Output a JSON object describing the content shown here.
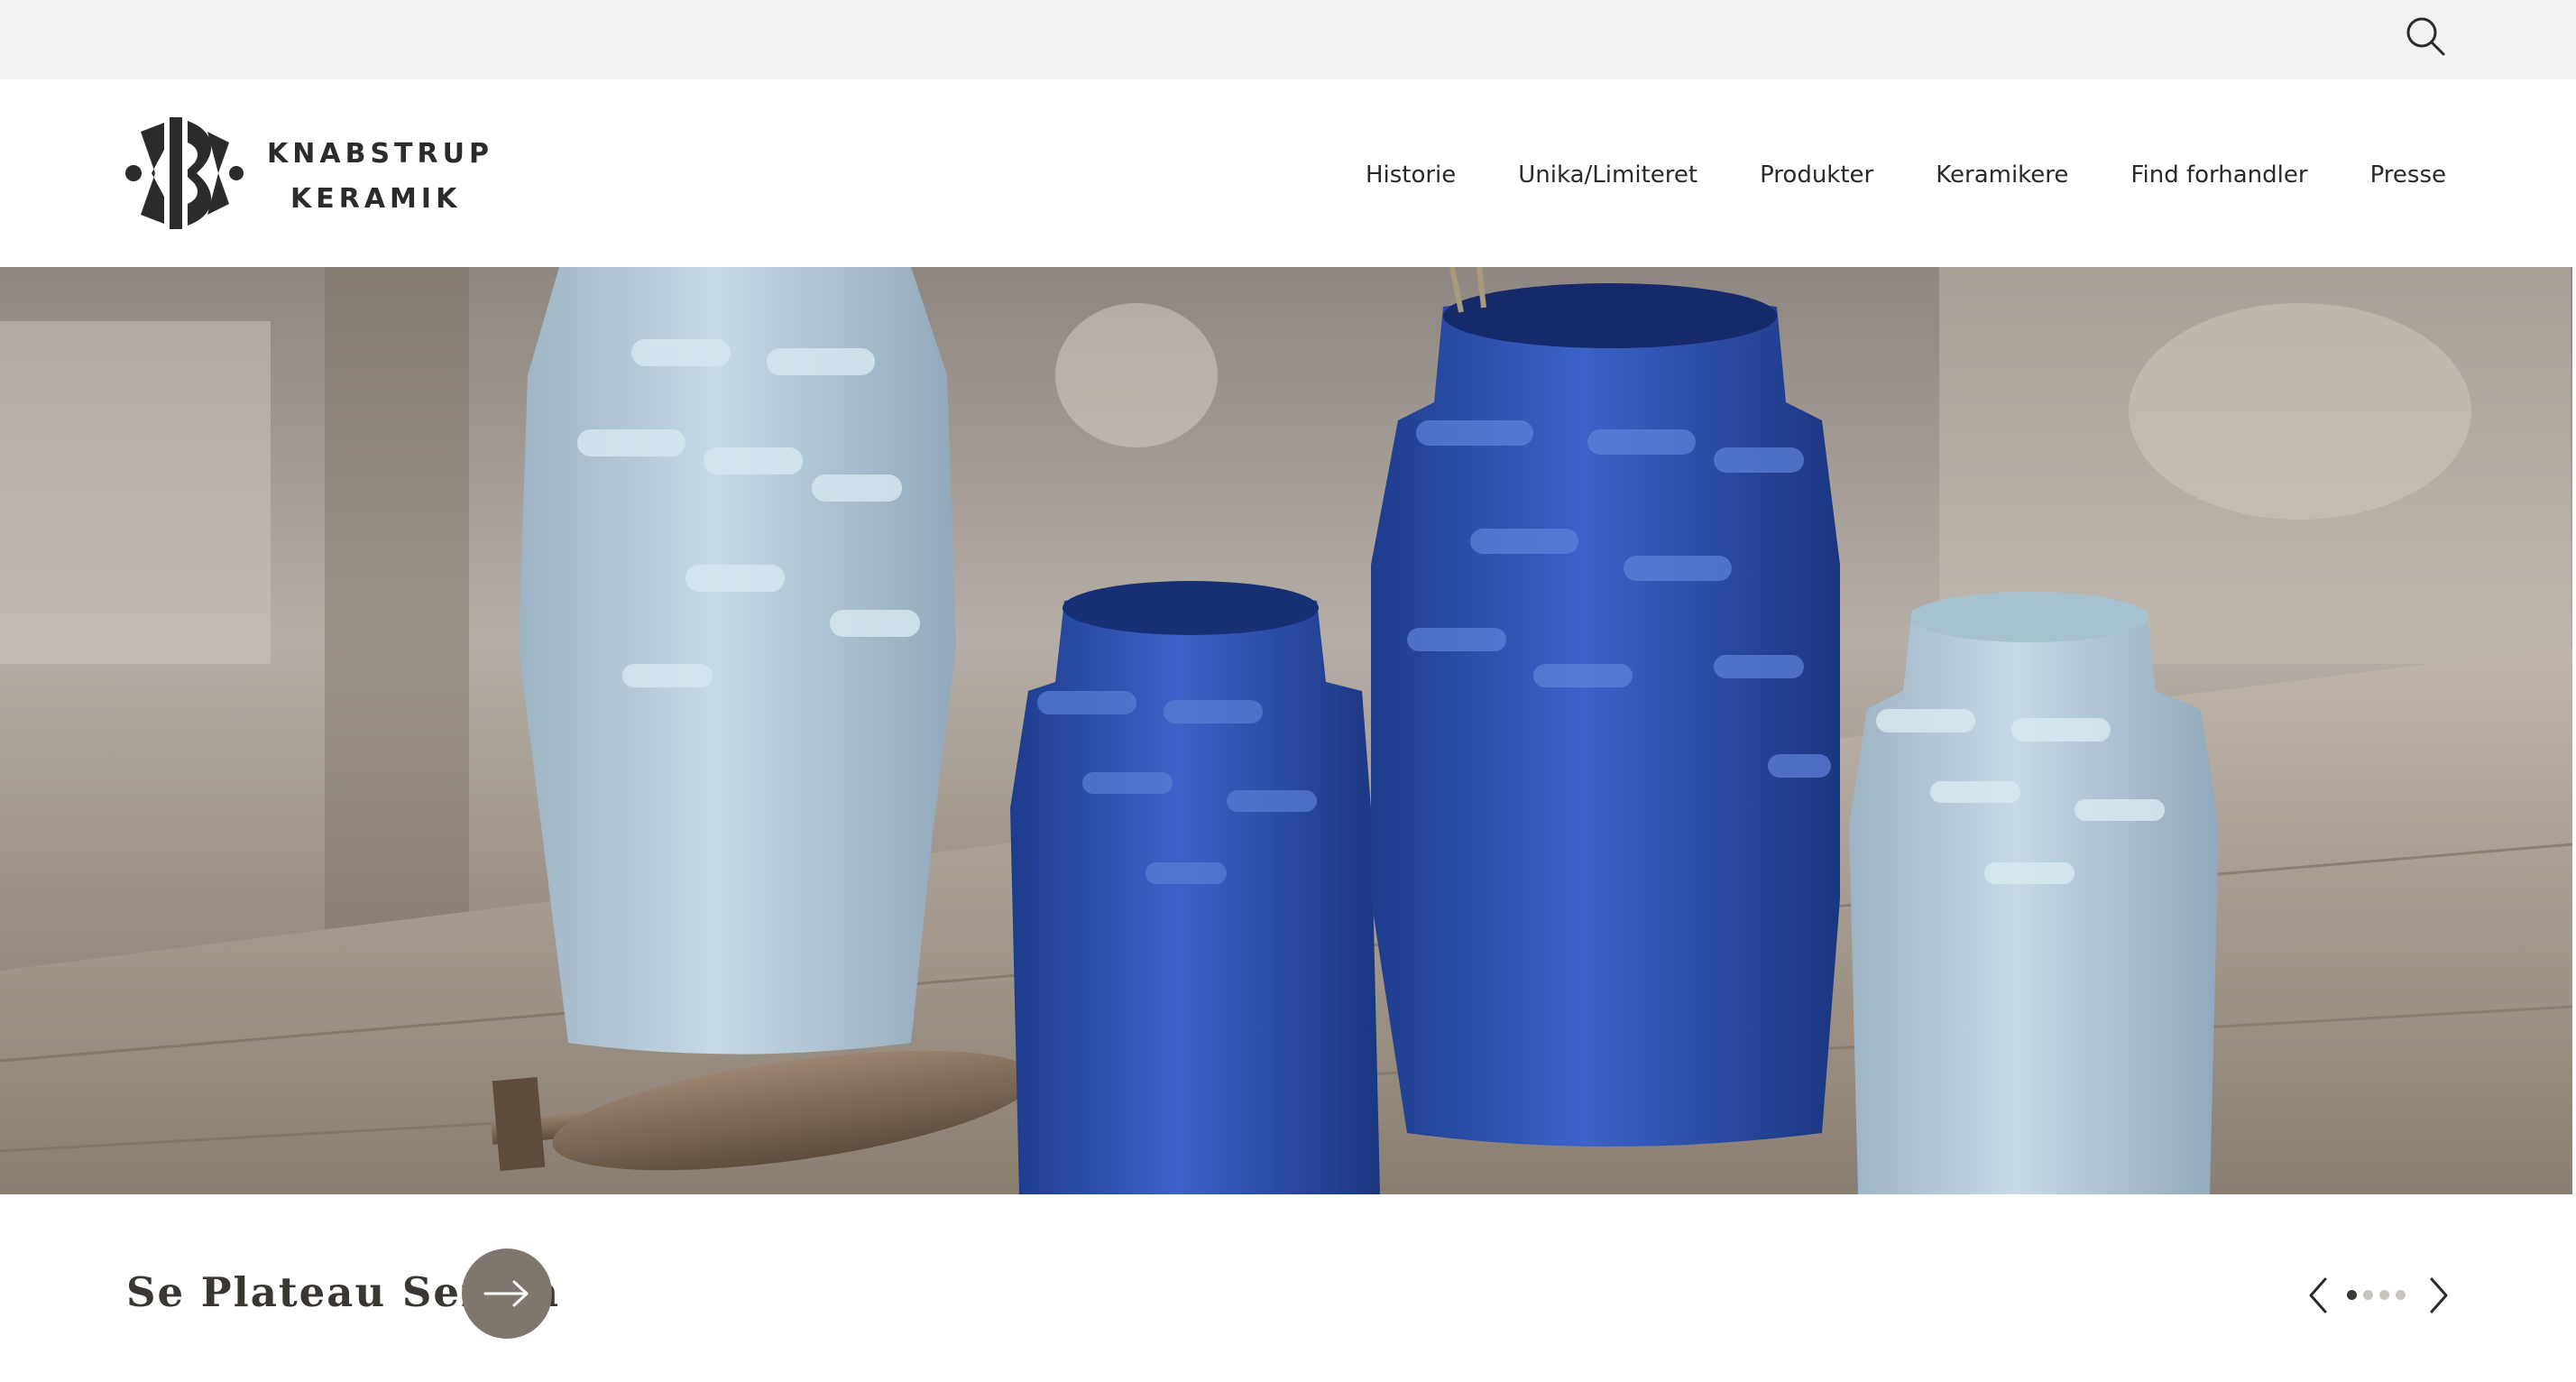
{
  "brand": {
    "name_line1": "KNABSTRUP",
    "name_line2": "KERAMIK"
  },
  "topbar": {
    "search_icon": "search-icon"
  },
  "nav": {
    "items": [
      {
        "label": "Historie"
      },
      {
        "label": "Unika/Limiteret"
      },
      {
        "label": "Produkter"
      },
      {
        "label": "Keramikere"
      },
      {
        "label": "Find forhandler"
      },
      {
        "label": "Presse"
      }
    ]
  },
  "hero": {
    "image": "hero-vases-photo"
  },
  "cta": {
    "title": "Se Plateau Serien",
    "icon": "arrow-right-icon"
  },
  "slider": {
    "prev_icon": "chevron-left-icon",
    "next_icon": "chevron-right-icon",
    "slide_count": 4,
    "active_slide": 1
  },
  "colors": {
    "topbar_bg": "#f3f2f0",
    "text": "#2a2a2a",
    "cta_button": "#7f776e",
    "vase_light": "#b9d0e0",
    "vase_dark": "#2f55b8"
  }
}
